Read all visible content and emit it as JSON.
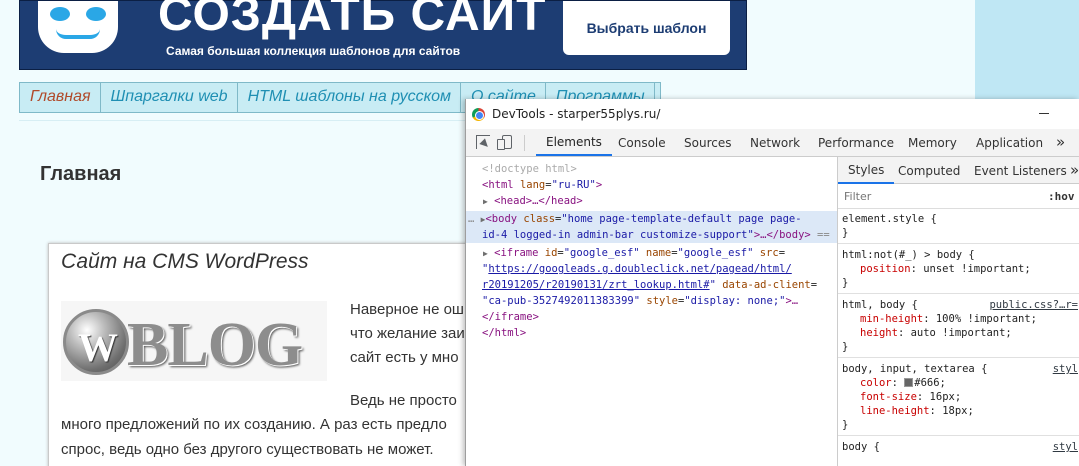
{
  "site": {
    "banner": {
      "title": "СОЗДАТЬ САЙТ",
      "subtitle": "Самая большая коллекция шаблонов для сайтов",
      "button": "Выбрать шаблон"
    },
    "nav": [
      {
        "label": "Главная"
      },
      {
        "label": "Шпаргалки web"
      },
      {
        "label": "HTML шаблоны на русском"
      },
      {
        "label": "О сайте"
      },
      {
        "label": "Программы"
      }
    ],
    "heading": "Главная",
    "post": {
      "title": "Сайт на CMS WordPress",
      "image_text": "BLOG",
      "image_letter": "W",
      "lines": [
        "Наверное не ош",
        "что желание заи",
        "сайт есть у мно",
        "Ведь не просто",
        "много предложений по их созданию. А раз есть предло",
        "спрос, ведь одно без другого существовать не может."
      ]
    }
  },
  "devtools": {
    "title": "DevTools - starper55plys.ru/",
    "tabs": [
      "Elements",
      "Console",
      "Sources",
      "Network",
      "Performance",
      "Memory",
      "Application"
    ],
    "active_tab": "Elements",
    "more": "»",
    "code": {
      "doctype": "<!doctype html>",
      "html_open_tag": "<html",
      "html_attr": "lang",
      "html_val": "\"ru-RU\"",
      "head": "<head>…</head>",
      "body_ellipsis": "…",
      "body_tag": "<body",
      "body_attr": "class",
      "body_val_1": "\"home page-template-default page page-",
      "body_val_2": "id-4 logged-in admin-bar customize-support\"",
      "body_close": ">…</body>",
      "body_marker": " ==",
      "iframe_tag": "<iframe",
      "iframe_id_attr": "id",
      "iframe_id_val": "\"google_esf\"",
      "iframe_name_attr": "name",
      "iframe_name_val": "\"google_esf\"",
      "iframe_src_attr": "src",
      "iframe_url_1": "https://googleads.g.doubleclick.net/pagead/html/",
      "iframe_url_2": "r20191205/r20190131/zrt_lookup.html#",
      "iframe_data_attr": "data-ad-client",
      "iframe_data_val": "\"ca-pub-3527492011383399\"",
      "iframe_style_attr": "style",
      "iframe_style_val": "\"display: none;\"",
      "iframe_close_tag": "/iframe",
      "html_close": "</html>"
    },
    "styles": {
      "tabs": [
        "Styles",
        "Computed",
        "Event Listeners"
      ],
      "active_tab": "Styles",
      "more": "»",
      "filter_placeholder": "Filter",
      "hov": ":hov",
      "element_style_selector": "element.style {",
      "close_brace": "}",
      "rule1_selector": "html:not(#_) > body {",
      "rule1_prop": "position",
      "rule1_val": ": unset !important;",
      "rule2_selector": "html, body {",
      "rule2_source": "public.css?…r=",
      "rule2_prop1": "min-height",
      "rule2_val1": ": 100% !important;",
      "rule2_prop2": "height",
      "rule2_val2": ": auto !important;",
      "rule3_selector": "body, input, textarea {",
      "rule3_source": "styl",
      "rule3_prop1": "color",
      "rule3_val1": "#666;",
      "rule3_prop2": "font-size",
      "rule3_val2": ": 16px;",
      "rule3_prop3": "line-height",
      "rule3_val3": ": 18px;",
      "rule4_selector": "body {",
      "rule4_source": "styl"
    }
  },
  "colors": {
    "banner": "#1d3d73",
    "nav_bg": "#c8ecf4",
    "nav_link": "#1f8fb3",
    "nav_active": "#b04a2a",
    "devtools_accent": "#1a73e8",
    "css_property": "#c80000",
    "html_tag": "#881280"
  }
}
